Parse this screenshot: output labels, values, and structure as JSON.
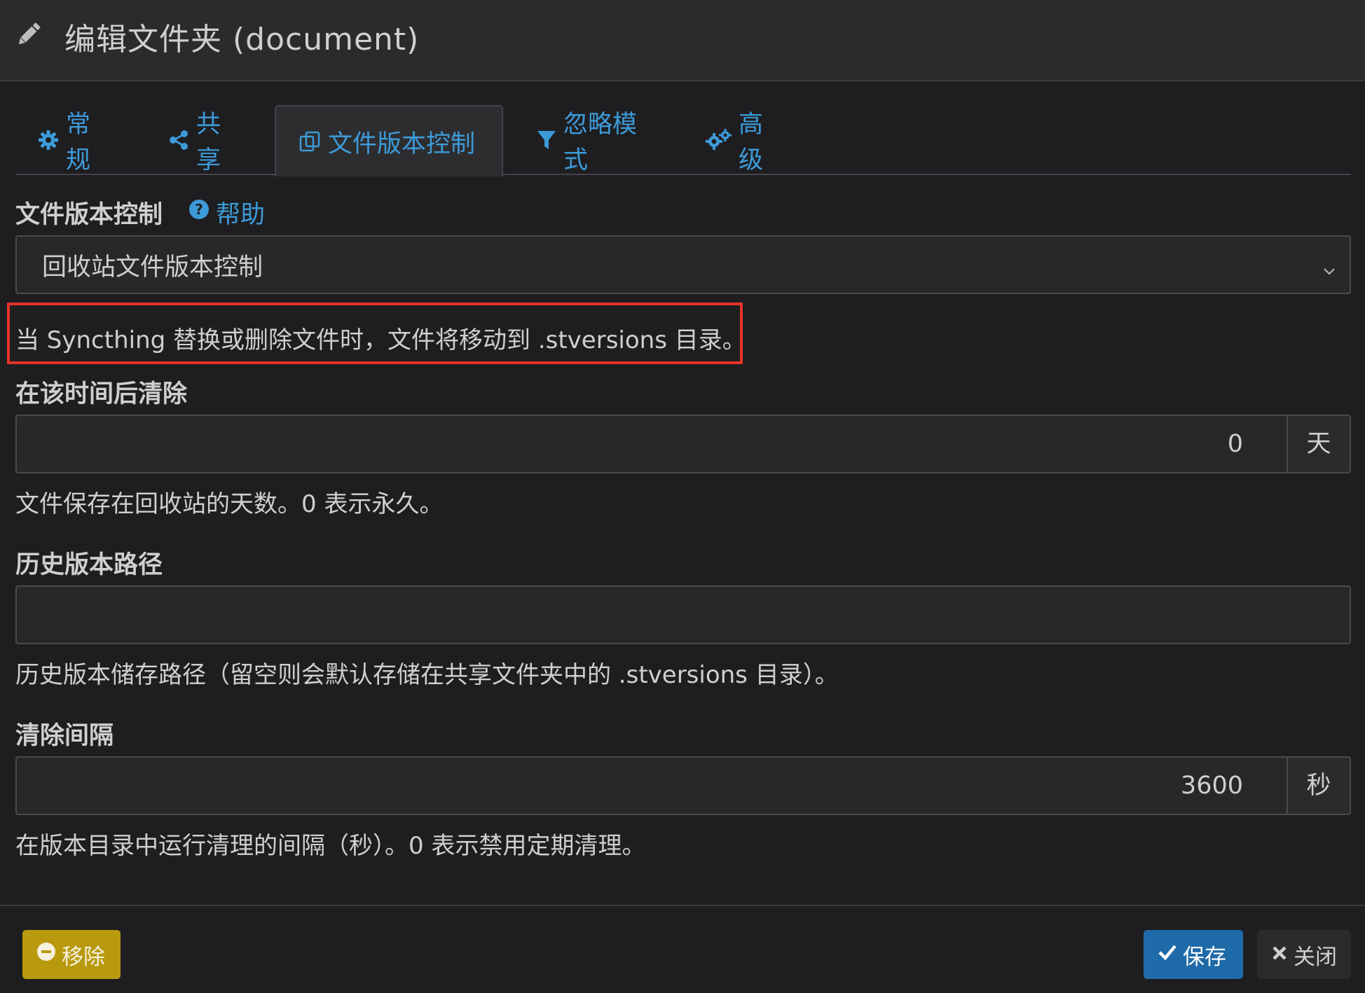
{
  "header": {
    "title": "编辑文件夹 (document)",
    "icon": "pencil-icon"
  },
  "tabs": [
    {
      "label": "常规",
      "icon": "gear-icon"
    },
    {
      "label": "共享",
      "icon": "share-icon"
    },
    {
      "label": "文件版本控制",
      "icon": "copy-icon",
      "active": true
    },
    {
      "label": "忽略模式",
      "icon": "filter-icon"
    },
    {
      "label": "高级",
      "icon": "gears-icon"
    }
  ],
  "versioning": {
    "label": "文件版本控制",
    "help_label": "帮助",
    "selected": "回收站文件版本控制",
    "description": "当 Syncthing 替换或删除文件时，文件将移动到 .stversions 目录。"
  },
  "cleanout": {
    "label": "在该时间后清除",
    "value": "0",
    "unit": "天",
    "help": "文件保存在回收站的天数。0 表示永久。"
  },
  "path": {
    "label": "历史版本路径",
    "value": "",
    "help": "历史版本储存路径（留空则会默认存储在共享文件夹中的 .stversions 目录）。"
  },
  "interval": {
    "label": "清除间隔",
    "value": "3600",
    "unit": "秒",
    "help": "在版本目录中运行清理的间隔（秒）。0 表示禁用定期清理。"
  },
  "footer": {
    "remove_label": "移除",
    "save_label": "保存",
    "close_label": "关闭"
  },
  "colors": {
    "accent": "#3d9ad8",
    "warning": "#b99a0f",
    "primary": "#1f6aa8",
    "highlight": "#e5332a"
  }
}
